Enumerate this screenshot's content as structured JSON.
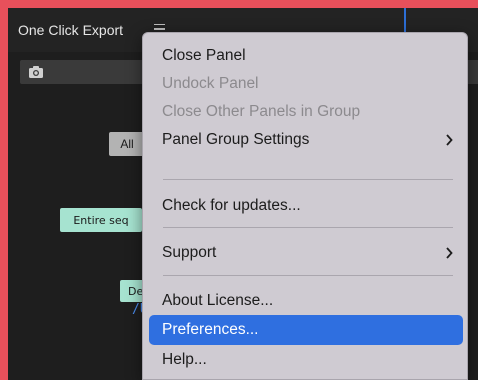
{
  "panel": {
    "title": "One Click Export",
    "buttons": {
      "all_label": "All",
      "entire_seq_label": "Entire seq",
      "def_label": "Def"
    },
    "path_text": "/U"
  },
  "menu": {
    "items": [
      {
        "label": "Close Panel",
        "enabled": true
      },
      {
        "label": "Undock Panel",
        "enabled": false
      },
      {
        "label": "Close Other Panels in Group",
        "enabled": false
      },
      {
        "label": "Panel Group Settings",
        "enabled": true,
        "submenu": true
      },
      {
        "label": "Check for updates...",
        "enabled": true
      },
      {
        "label": "Support",
        "enabled": true,
        "submenu": true
      },
      {
        "label": "About  License...",
        "enabled": true
      },
      {
        "label": "Preferences...",
        "enabled": true,
        "selected": true
      },
      {
        "label": "Help...",
        "enabled": true
      }
    ]
  },
  "colors": {
    "border": "#e8505b",
    "panel_bg": "#1e1e1e",
    "menu_bg": "#cfcbd2",
    "selection": "#2f6fe0",
    "teal_button": "#a6e3d0",
    "path_blue": "#4a8df0"
  },
  "icons": {
    "menu": "hamburger-menu-icon",
    "camera": "camera-icon",
    "submenu": "chevron-right-icon"
  }
}
